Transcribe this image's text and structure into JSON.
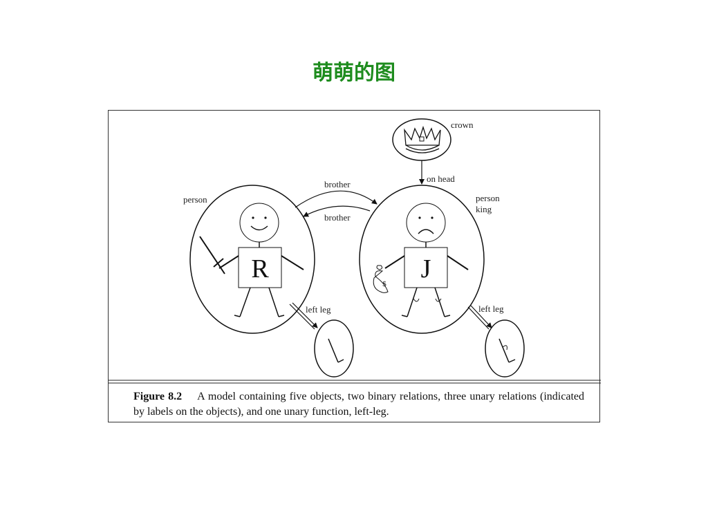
{
  "slide": {
    "title": "萌萌的图"
  },
  "diagram": {
    "labels": {
      "crown": "crown",
      "on_head": "on head",
      "brother_top": "brother",
      "brother_bottom": "brother",
      "person_left": "person",
      "person_right": "person",
      "king": "king",
      "left_leg_1": "left leg",
      "left_leg_2": "left leg"
    },
    "box_left": "R",
    "box_right": "J",
    "moneybag_symbol": "$"
  },
  "caption": {
    "label": "Figure 8.2",
    "text": "A model containing five objects, two binary relations, three unary relations (indicated by labels on the objects), and one unary function, left-leg."
  }
}
